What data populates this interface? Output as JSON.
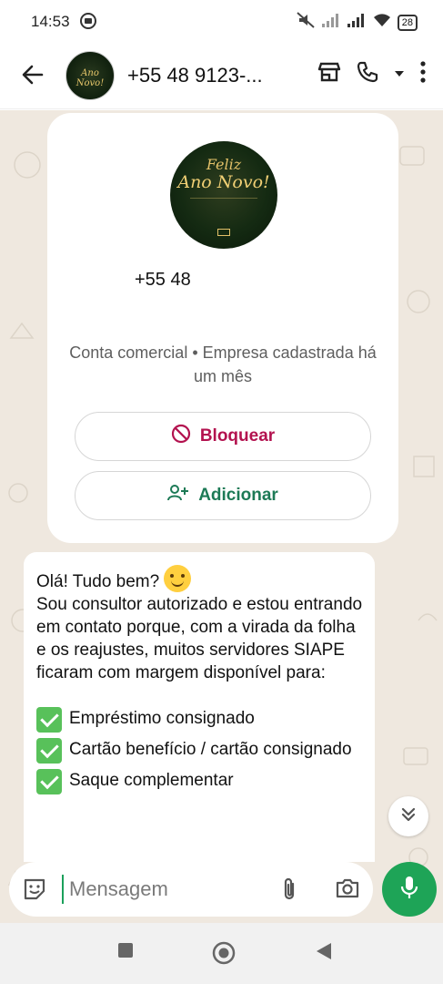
{
  "status_bar": {
    "time": "14:53",
    "battery": "28"
  },
  "header": {
    "contact_name": "+55 48 9123-..."
  },
  "business_card": {
    "avatar_text_line1": "Feliz",
    "avatar_text_line2": "Ano Novo!",
    "phone": "+55 48",
    "description": "Conta comercial • Empresa cadastrada há um mês",
    "block_label": "Bloquear",
    "add_label": "Adicionar"
  },
  "message": {
    "greeting": "Olá! Tudo bem?",
    "body": "Sou consultor autorizado e estou entrando em contato porque, com a virada da folha e os reajustes, muitos servidores SIAPE ficaram com margem disponível para:",
    "items": [
      "Empréstimo consignado",
      "Cartão benefício / cartão consignado",
      "Saque complementar"
    ]
  },
  "composer": {
    "placeholder": "Mensagem"
  },
  "colors": {
    "chat_background": "#efe8df",
    "accent_green": "#1ea457",
    "block_red": "#b3124f",
    "add_green": "#1d7a56"
  }
}
